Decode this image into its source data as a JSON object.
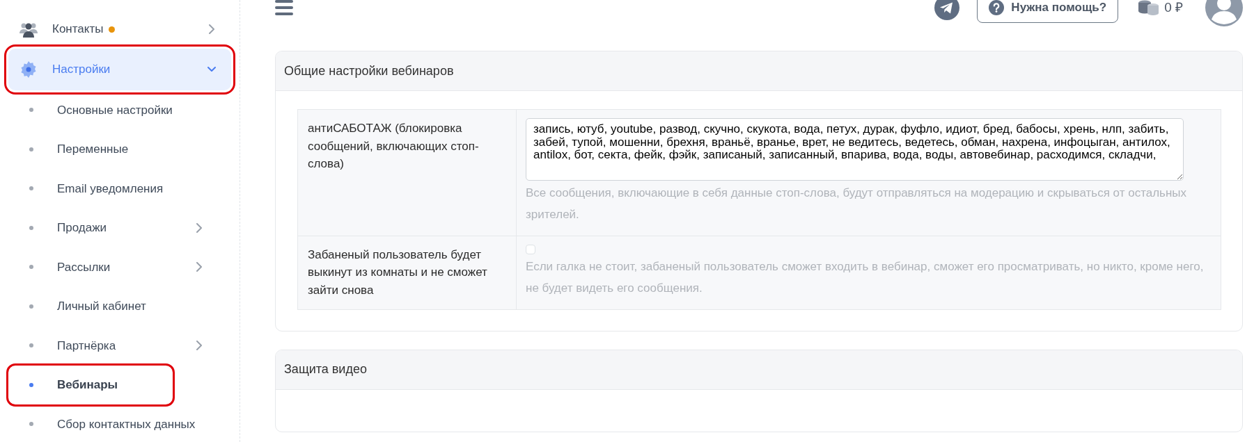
{
  "header": {
    "help_button": "Нужна помощь?",
    "balance": "0 ₽"
  },
  "sidebar": {
    "items": [
      {
        "label": "Контакты",
        "notification": true,
        "expanded": false,
        "selected": false,
        "annotated": false
      },
      {
        "label": "Настройки",
        "notification": false,
        "expanded": true,
        "selected": true,
        "annotated": true,
        "children": [
          {
            "label": "Основные настройки",
            "has_submenu": false,
            "selected": false,
            "annotated": false
          },
          {
            "label": "Переменные",
            "has_submenu": false,
            "selected": false,
            "annotated": false
          },
          {
            "label": "Email уведомления",
            "has_submenu": false,
            "selected": false,
            "annotated": false
          },
          {
            "label": "Продажи",
            "has_submenu": true,
            "selected": false,
            "annotated": false
          },
          {
            "label": "Рассылки",
            "has_submenu": true,
            "selected": false,
            "annotated": false
          },
          {
            "label": "Личный кабинет",
            "has_submenu": false,
            "selected": false,
            "annotated": false
          },
          {
            "label": "Партнёрка",
            "has_submenu": true,
            "selected": false,
            "annotated": false
          },
          {
            "label": "Вебинары",
            "has_submenu": false,
            "selected": true,
            "annotated": true
          },
          {
            "label": "Сбор контактных данных",
            "has_submenu": false,
            "selected": false,
            "annotated": false
          }
        ]
      }
    ]
  },
  "cards": [
    {
      "title": "Общие настройки вебинаров",
      "rows": [
        {
          "kind": "textarea",
          "label": "антиСАБОТАЖ (блокировка сообщений, включающих стоп-слова)",
          "value": "запись, ютуб, youtube, развод, скучно, скукота, вода, петух, дурак, фуфло, идиот, бред, бабосы, хрень, нлп, забить, забей, тупой, мошенни, брехня, враньё, вранье, врет, не ведитесь, ведетесь, обман, нахрена, инфоцыган, антилох, antilox, бот, секта, фейк, фэйк, записаный, записанный, впарива, вода, воды, автовебинар, расходимся, складчи,",
          "hint": "Все сообщения, включающие в себя данные стоп-слова, будут отправляться на модерацию и скрываться от остальных зрителей."
        },
        {
          "kind": "checkbox",
          "label": "Забаненый пользователь будет выкинут из комнаты и не сможет зайти снова",
          "checked": false,
          "hint": "Если галка не стоит, забаненый пользователь сможет входить в вебинар, сможет его просматривать, но никто, кроме него, не будет видеть его сообщения."
        }
      ]
    },
    {
      "title": "Защита видео"
    }
  ]
}
